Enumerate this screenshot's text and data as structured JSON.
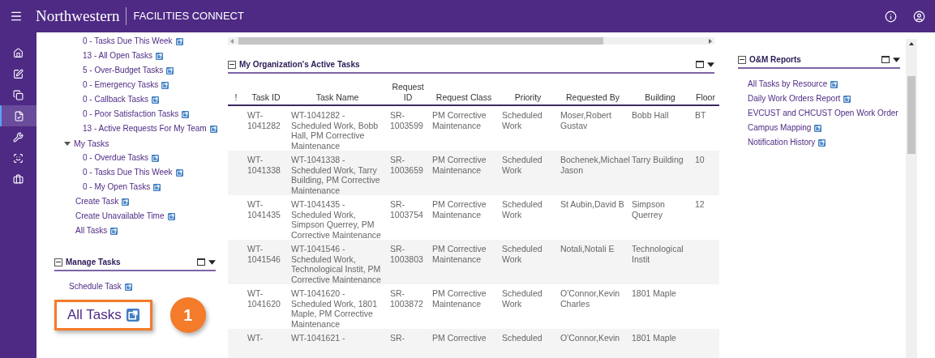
{
  "header": {
    "brand": "Northwestern",
    "product": "FACILITIES CONNECT"
  },
  "rail": [
    {
      "kind": "home",
      "selected": false
    },
    {
      "kind": "edit",
      "selected": false
    },
    {
      "kind": "copy",
      "selected": false
    },
    {
      "kind": "document",
      "selected": true
    },
    {
      "kind": "wrench",
      "selected": false
    },
    {
      "kind": "scan",
      "selected": false
    },
    {
      "kind": "briefcase",
      "selected": false
    }
  ],
  "nav_links_top": [
    "0 - Tasks Due This Week",
    "13 - All Open Tasks",
    "5 - Over-Budget Tasks",
    "0 - Emergency Tasks",
    "0 - Callback Tasks",
    "0 - Poor Satisfaction Tasks",
    "13 - Active Requests For My Team"
  ],
  "my_tasks": {
    "label": "My Tasks",
    "expanded": true,
    "children": [
      "0 - Overdue Tasks",
      "0 - Tasks Due This Week",
      "0 - My Open Tasks"
    ]
  },
  "nav_links": [
    "Create Task",
    "Create Unavailable Time",
    "All Tasks"
  ],
  "manage_tasks": {
    "title": "Manage Tasks",
    "links": [
      "Schedule Task"
    ],
    "highlighted_link": "All Tasks"
  },
  "callout": {
    "number": "1"
  },
  "table": {
    "title": "My Organization's Active Tasks",
    "columns": [
      "!",
      "Task ID",
      "Task Name",
      "Request ID",
      "Request Class",
      "Priority",
      "Requested By",
      "Building",
      "Floor"
    ],
    "rows": [
      [
        "",
        "WT-1041282",
        "WT-1041282 - Scheduled Work, Bobb Hall, PM Corrective Maintenance",
        "SR-1003599",
        "PM Corrective Maintenance",
        "Scheduled Work",
        "Moser,Robert Gustav",
        "Bobb Hall",
        "BT"
      ],
      [
        "",
        "WT-1041338",
        "WT-1041338 - Scheduled Work, Tarry Building, PM Corrective Maintenance",
        "SR-1003659",
        "PM Corrective Maintenance",
        "Scheduled Work",
        "Bochenek,Michael Jason",
        "Tarry Building",
        "10"
      ],
      [
        "",
        "WT-1041435",
        "WT-1041435 - Scheduled Work, Simpson Querrey, PM Corrective Maintenance",
        "SR-1003754",
        "PM Corrective Maintenance",
        "Scheduled Work",
        "St Aubin,David B",
        "Simpson Querrey",
        "12"
      ],
      [
        "",
        "WT-1041546",
        "WT-1041546 - Scheduled Work, Technological Instit, PM Corrective Maintenance",
        "SR-1003803",
        "PM Corrective Maintenance",
        "Scheduled Work",
        "Notali,Notali E",
        "Technological Instit",
        ""
      ],
      [
        "",
        "WT-1041620",
        "WT-1041620 - Scheduled Work, 1801 Maple, PM Corrective Maintenance",
        "SR-1003872",
        "PM Corrective Maintenance",
        "Scheduled Work",
        "O'Connor,Kevin Charles",
        "1801 Maple",
        ""
      ],
      [
        "",
        "WT-",
        "WT-1041621 -",
        "SR-",
        "PM Corrective",
        "Scheduled",
        "O'Connor,Kevin",
        "1801 Maple",
        ""
      ]
    ]
  },
  "reports": {
    "title": "O&M Reports",
    "links": [
      {
        "label": "All Tasks by Resource",
        "icon": true
      },
      {
        "label": "Daily Work Orders Report",
        "icon": true
      },
      {
        "label": "EVCUST and CHCUST Open Work Order",
        "icon": false
      },
      {
        "label": "Campus Mapping",
        "icon": true
      },
      {
        "label": "Notification History",
        "icon": true
      }
    ]
  }
}
